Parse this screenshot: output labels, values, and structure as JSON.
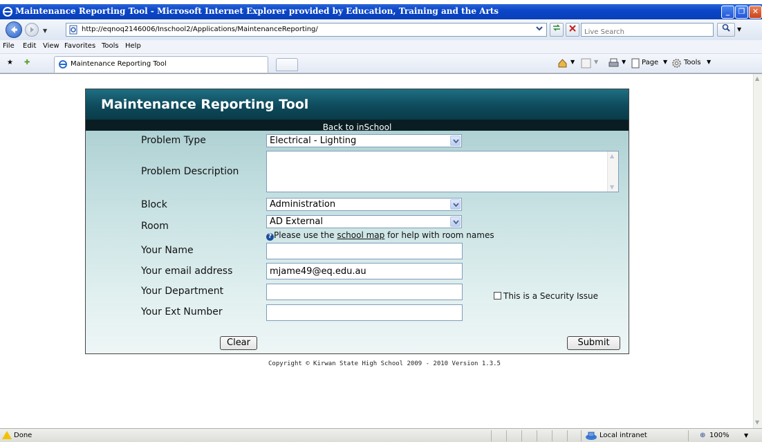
{
  "browser": {
    "window_title": "Maintenance Reporting Tool - Microsoft Internet Explorer provided by Education, Training and the Arts",
    "url": "http://eqnoq2146006/Inschool2/Applications/MaintenanceReporting/",
    "search_placeholder": "Live Search",
    "menu": [
      "File",
      "Edit",
      "View",
      "Favorites",
      "Tools",
      "Help"
    ],
    "tab_label": "Maintenance Reporting Tool",
    "cmd_page": "Page",
    "cmd_tools": "Tools",
    "status_text": "Done",
    "zone": "Local intranet",
    "zoom": "100%"
  },
  "form": {
    "title": "Maintenance Reporting Tool",
    "back_link": "Back to inSchool",
    "labels": {
      "problem_type": "Problem Type",
      "problem_description": "Problem Description",
      "block": "Block",
      "room": "Room",
      "name": "Your Name",
      "email": "Your email address",
      "department": "Your Department",
      "ext": "Your Ext Number"
    },
    "values": {
      "problem_type": "Electrical - Lighting",
      "block": "Administration",
      "room": "AD External",
      "name": "",
      "email": "mjame49@eq.edu.au",
      "department": "",
      "ext": ""
    },
    "help_prefix": "Please use the ",
    "help_link": "school map",
    "help_suffix": " for help with room names",
    "security_label": "This is a Security Issue",
    "clear_label": "Clear",
    "submit_label": "Submit"
  },
  "footer": {
    "copyright": "Copyright © Kirwan State High School 2009 - 2010 Version 1.3.5"
  }
}
